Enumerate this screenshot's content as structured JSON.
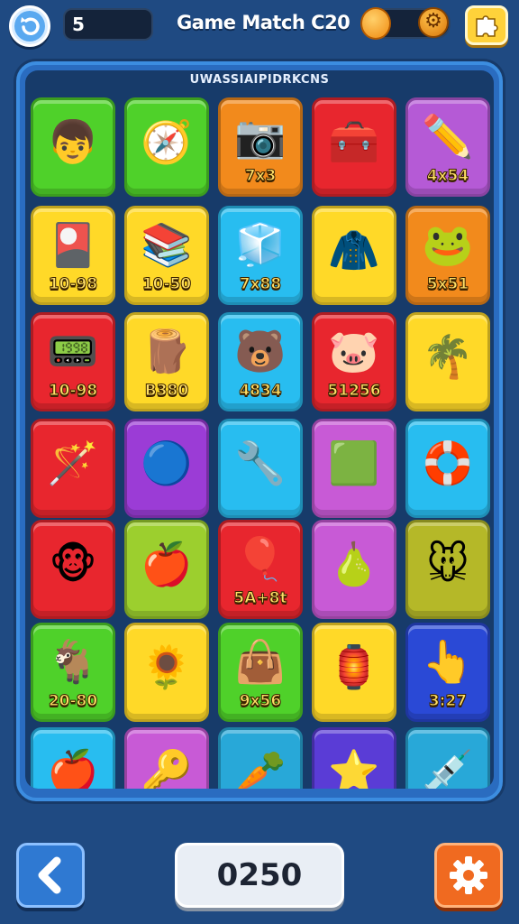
{
  "topbar": {
    "moves_counter": "5",
    "title": "Game Match C20",
    "icons": {
      "back": "refresh-arrow-icon",
      "coin": "coin-icon",
      "gear": "gear-coin-icon",
      "puzzle": "puzzle-icon"
    }
  },
  "board": {
    "header": "UWASSIAIPIDRKCNS",
    "tiles": [
      {
        "art": "👦",
        "label": "",
        "color": "#4fd12a"
      },
      {
        "art": "🧭",
        "label": "",
        "color": "#4fd12a"
      },
      {
        "art": "📷",
        "label": "7x3",
        "color": "#f28a1c"
      },
      {
        "art": "🧰",
        "label": "",
        "color": "#e8262e"
      },
      {
        "art": "✏️",
        "label": "4x54",
        "color": "#b55ad6"
      },
      {
        "art": "🎴",
        "label": "10-98",
        "color": "#ffd928"
      },
      {
        "art": "📚",
        "label": "10-50",
        "color": "#ffd928"
      },
      {
        "art": "🧊",
        "label": "7x88",
        "color": "#28bdf0"
      },
      {
        "art": "🧥",
        "label": "",
        "color": "#ffd928"
      },
      {
        "art": "🐸",
        "label": "5x51",
        "color": "#f28a1c"
      },
      {
        "art": "📟",
        "label": "10-98",
        "color": "#e8262e"
      },
      {
        "art": "🪵",
        "label": "B380",
        "color": "#ffd928"
      },
      {
        "art": "🐻",
        "label": "4834",
        "color": "#28bdf0"
      },
      {
        "art": "🐷",
        "label": "51256",
        "color": "#e8262e"
      },
      {
        "art": "🌴",
        "label": "",
        "color": "#ffd928"
      },
      {
        "art": "🪄",
        "label": "",
        "color": "#e8262e"
      },
      {
        "art": "🔵",
        "label": "",
        "color": "#9b3cd6"
      },
      {
        "art": "🔧",
        "label": "",
        "color": "#28bdf0"
      },
      {
        "art": "🟩",
        "label": "",
        "color": "#c85ad6"
      },
      {
        "art": "🛟",
        "label": "",
        "color": "#28bdf0"
      },
      {
        "art": "🐵",
        "label": "",
        "color": "#e8262e"
      },
      {
        "art": "🍎",
        "label": "",
        "color": "#9ccf2e"
      },
      {
        "art": "🎈",
        "label": "5A+8t",
        "color": "#e8262e"
      },
      {
        "art": "🍐",
        "label": "",
        "color": "#c85ad6"
      },
      {
        "art": "🐭",
        "label": "",
        "color": "#b5b828"
      },
      {
        "art": "🐐",
        "label": "20-80",
        "color": "#4fd12a"
      },
      {
        "art": "🌻",
        "label": "",
        "color": "#ffd928"
      },
      {
        "art": "👜",
        "label": "9x56",
        "color": "#4fd12a"
      },
      {
        "art": "🏮",
        "label": "",
        "color": "#ffd928"
      },
      {
        "art": "👆",
        "label": "3:27",
        "color": "#2a49d6"
      },
      {
        "art": "🍎",
        "label": "",
        "color": "#28bdf0"
      },
      {
        "art": "🔑",
        "label": "",
        "color": "#c85ad6"
      },
      {
        "art": "🥕",
        "label": "",
        "color": "#28a8d8"
      },
      {
        "art": "⭐",
        "label": "",
        "color": "#5a3cd6"
      },
      {
        "art": "💉",
        "label": "",
        "color": "#28a8d8"
      }
    ]
  },
  "bottom": {
    "score": "0250",
    "back_glyph": "‹",
    "settings_glyph": "⚙"
  }
}
